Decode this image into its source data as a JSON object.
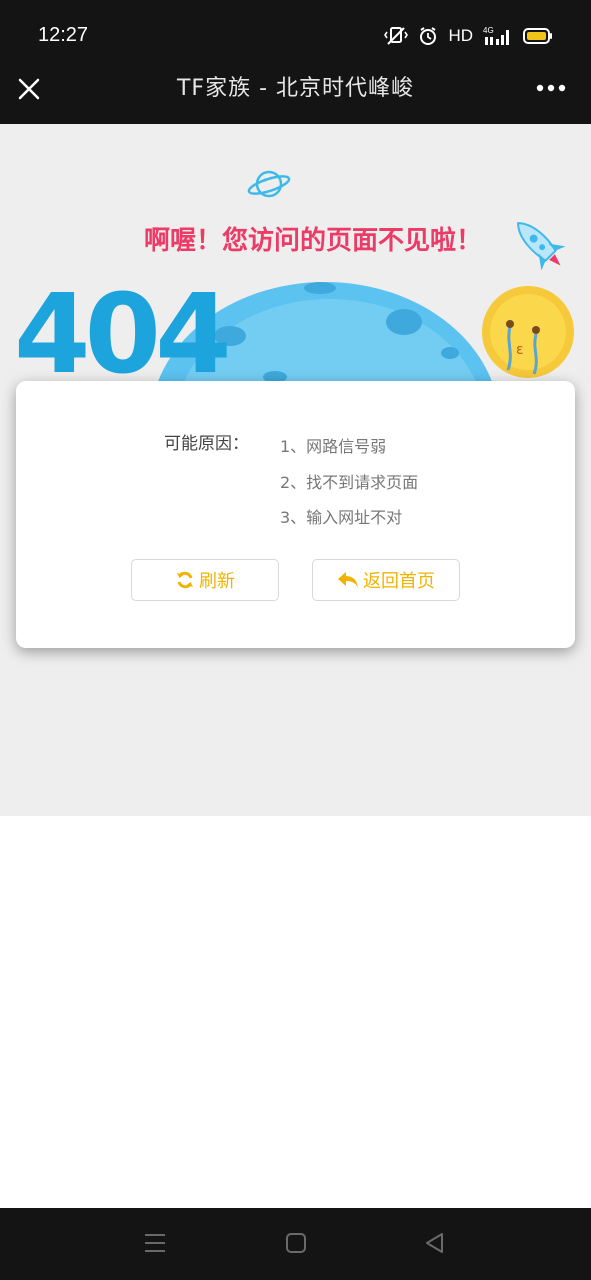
{
  "status_bar": {
    "time": "12:27",
    "network": "HD",
    "network_type": "4G",
    "icons": [
      "vibrate-icon",
      "alarm-icon",
      "signal-icon",
      "battery-icon"
    ]
  },
  "title_bar": {
    "title": "TF家族 - 北京时代峰峻",
    "close_icon": "close-icon",
    "more_icon": "more-icon"
  },
  "error_page": {
    "heading": "啊喔！您访问的页面不见啦！",
    "code": "404",
    "reasons_label": "可能原因：",
    "reasons": [
      "1、网路信号弱",
      "2、找不到请求页面",
      "3、输入网址不对"
    ],
    "refresh_label": "刷新",
    "home_label": "返回首页",
    "accent_color": "#f0b400",
    "heading_color": "#ec3b67"
  },
  "nav_bar": {
    "buttons": [
      "menu-icon",
      "home-icon",
      "back-icon"
    ]
  }
}
